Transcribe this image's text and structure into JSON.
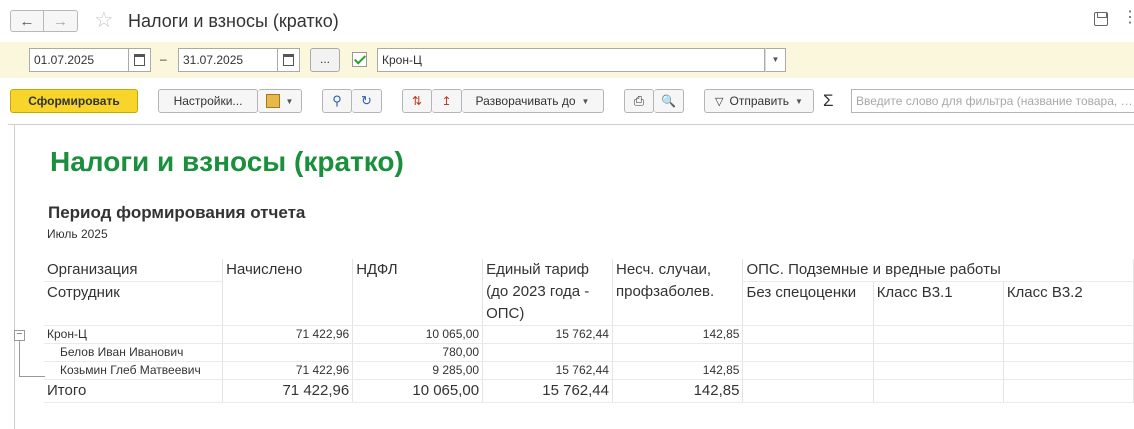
{
  "window": {
    "title": "Налоги и взносы (кратко)",
    "back_icon": "arrow-left-icon",
    "forward_icon": "arrow-right-icon",
    "favorite_icon": "star-icon",
    "save_icon": "save-icon",
    "more_icon": "more-vertical-icon"
  },
  "filters": {
    "date_from": "01.07.2025",
    "date_to": "31.07.2025",
    "dash": "–",
    "period_button": "...",
    "org_enabled": true,
    "organization": "Крон-Ц"
  },
  "toolbar": {
    "generate": "Сформировать",
    "settings": "Настройки...",
    "expand": "Разворачивать до",
    "send": "Отправить",
    "sigma": "Σ",
    "filter_placeholder": "Введите слово для фильтра (название товара, …"
  },
  "report": {
    "title": "Налоги и взносы (кратко)",
    "period_heading": "Период формирования отчета",
    "period_value": "Июль 2025",
    "headers": {
      "organization": "Организация",
      "employee": "Сотрудник",
      "accrued": "Начислено",
      "ndfl": "НДФЛ",
      "single_tariff": "Единый тариф (до 2023 года - ОПС)",
      "accidents": "Несч. случаи, профзаболев.",
      "ops_group": "ОПС. Подземные и вредные работы",
      "no_assessment": "Без спецоценки",
      "class_31": "Класс В3.1",
      "class_32": "Класс В3.2"
    },
    "org_row": {
      "name": "Крон-Ц",
      "accrued": "71 422,96",
      "ndfl": "10 065,00",
      "single_tariff": "15 762,44",
      "accidents": "142,85"
    },
    "employees": [
      {
        "name": "Белов Иван Иванович",
        "accrued": "",
        "ndfl": "780,00",
        "single_tariff": "",
        "accidents": ""
      },
      {
        "name": "Козьмин Глеб Матвеевич",
        "accrued": "71 422,96",
        "ndfl": "9 285,00",
        "single_tariff": "15 762,44",
        "accidents": "142,85"
      }
    ],
    "total": {
      "label": "Итого",
      "accrued": "71 422,96",
      "ndfl": "10 065,00",
      "single_tariff": "15 762,44",
      "accidents": "142,85"
    }
  }
}
